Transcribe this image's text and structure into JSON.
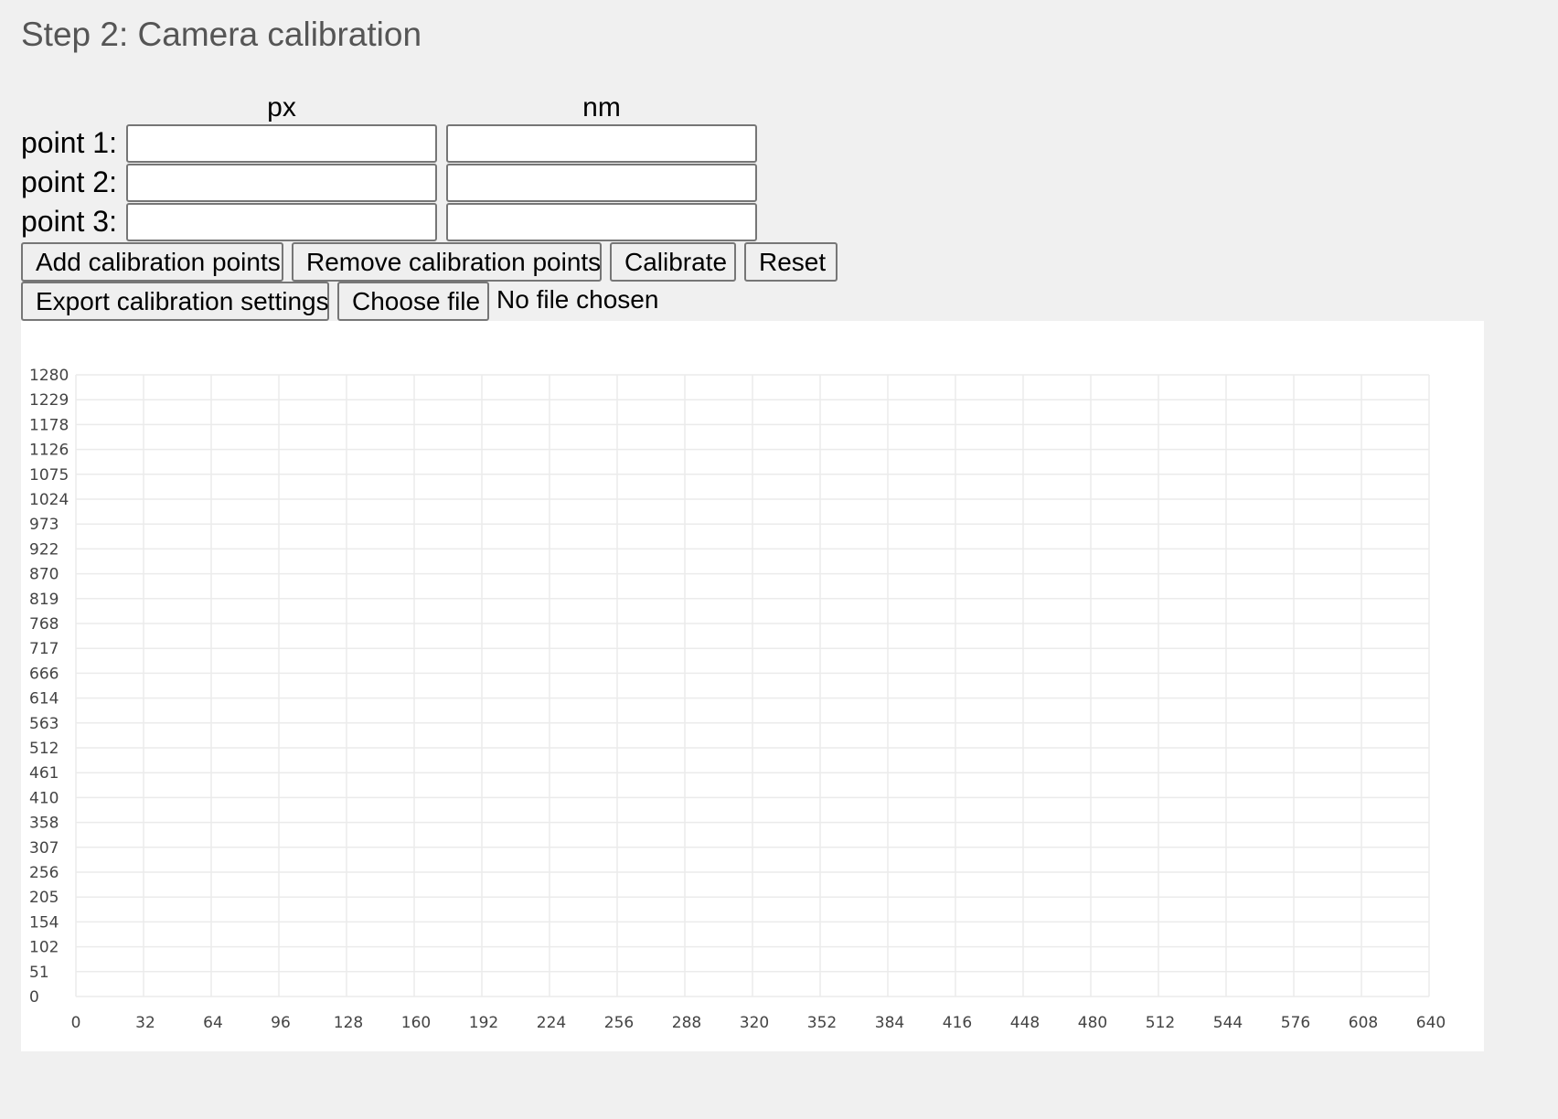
{
  "page": {
    "title": "Step 2: Camera calibration"
  },
  "calibration": {
    "column_px": "px",
    "column_nm": "nm",
    "points": [
      {
        "label": "point 1:",
        "px": "",
        "nm": ""
      },
      {
        "label": "point 2:",
        "px": "",
        "nm": ""
      },
      {
        "label": "point 3:",
        "px": "",
        "nm": ""
      }
    ]
  },
  "buttons": {
    "add": "Add calibration points",
    "remove": "Remove calibration points",
    "calibrate": "Calibrate",
    "reset": "Reset",
    "export": "Export calibration settings",
    "choose_file": "Choose file",
    "file_status": "No file chosen"
  },
  "chart_data": {
    "type": "scatter",
    "title": "",
    "xlabel": "",
    "ylabel": "",
    "xlim": [
      0,
      640
    ],
    "ylim": [
      0,
      1280
    ],
    "grid": true,
    "x_ticks": [
      "0",
      "32",
      "64",
      "96",
      "128",
      "160",
      "192",
      "224",
      "256",
      "288",
      "320",
      "352",
      "384",
      "416",
      "448",
      "480",
      "512",
      "544",
      "576",
      "608",
      "640"
    ],
    "y_ticks": [
      "0",
      "51",
      "102",
      "154",
      "205",
      "256",
      "307",
      "358",
      "410",
      "461",
      "512",
      "563",
      "614",
      "666",
      "717",
      "768",
      "819",
      "870",
      "922",
      "973",
      "1024",
      "1075",
      "1126",
      "1178",
      "1229",
      "1280"
    ],
    "series": []
  }
}
